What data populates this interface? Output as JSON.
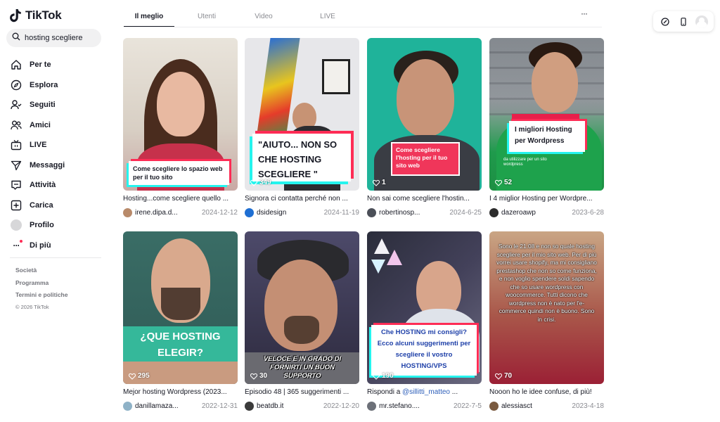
{
  "app": {
    "brand": "TikTok"
  },
  "search": {
    "value": "hosting scegliere"
  },
  "nav": [
    {
      "label": "Per te",
      "icon": "home-icon"
    },
    {
      "label": "Esplora",
      "icon": "compass-icon"
    },
    {
      "label": "Seguiti",
      "icon": "following-icon"
    },
    {
      "label": "Amici",
      "icon": "friends-icon"
    },
    {
      "label": "LIVE",
      "icon": "live-icon"
    },
    {
      "label": "Messaggi",
      "icon": "messages-icon"
    },
    {
      "label": "Attività",
      "icon": "activity-icon"
    },
    {
      "label": "Carica",
      "icon": "upload-icon"
    },
    {
      "label": "Profilo",
      "icon": "profile-avatar"
    },
    {
      "label": "Di più",
      "icon": "more-icon"
    }
  ],
  "footer": {
    "company": "Società",
    "program": "Programma",
    "terms": "Termini e politiche",
    "copyright": "© 2026 TikTok"
  },
  "tabs": [
    "Il meglio",
    "Utenti",
    "Video",
    "LIVE"
  ],
  "active_tab": "Il meglio",
  "more_label": "···",
  "videos": [
    {
      "overlay": "Come scegliere lo spazio web per il tuo sito",
      "likes": "",
      "caption": "Hosting...come scegliere quello ...",
      "user": "irene.dipa.d...",
      "date": "2024-12-12"
    },
    {
      "overlay": "\"AIUTO... NON SO CHE HOSTING SCEGLIERE \"",
      "likes": "349",
      "caption": "Signora ci contatta perché non ...",
      "user": "dsidesign",
      "date": "2024-11-19"
    },
    {
      "overlay": "Come scegliere l'hosting per il tuo sito web",
      "likes": "1",
      "caption": "Non sai come scegliere l'hostin...",
      "user": "robertinosp...",
      "date": "2024-6-25"
    },
    {
      "overlay": "I migliori Hosting per Wordpress",
      "overlay_small": "da utilizzare per un sito wordpress",
      "likes": "52",
      "caption": "I 4 miglior Hosting per Wordpre...",
      "user": "dazeroawp",
      "date": "2023-6-28"
    },
    {
      "overlay": "¿QUE HOSTING ELEGIR?",
      "likes": "295",
      "caption": "Mejor hosting Wordpress (2023...",
      "user": "danillamaza...",
      "date": "2022-12-31"
    },
    {
      "overlay": "VELOCE E IN GRADO DI FORNIRTI UN BUON SUPPORTO",
      "likes": "30",
      "caption": "Episodio 48 | 365 suggerimenti ...",
      "user": "beatdb.it",
      "date": "2022-12-20"
    },
    {
      "overlay": "Che HOSTING mi consigli? Ecco alcuni suggerimenti per scegliere il vostro HOSTING/VPS",
      "likes": "190",
      "caption_prefix": "Rispondi a ",
      "caption_mention": "@sillitti_matteo",
      "caption_suffix": " ...",
      "user": "mr.stefano....",
      "date": "2022-7-5"
    },
    {
      "overlay": "Sono le 21:08 e non so quale hosting scegliere per il mio sito web. Per di più vorrei usare shopify, ma mi consigliano prestashop che non so come funziona, e non voglio spendere soldi sapendo che so usare wordpress con woocommerce. Tutti dicono che wordpress non è nato per l'e-commerce quindi non è buono. Sono in crisi.",
      "likes": "70",
      "caption": "Nooon ho le idee confuse, di più!",
      "user": "alessiasct",
      "date": "2023-4-18"
    }
  ],
  "colors": {
    "accent": "#fe2c55",
    "cyan": "#25f4ee",
    "text": "#161823",
    "muted": "#8a8b91"
  }
}
